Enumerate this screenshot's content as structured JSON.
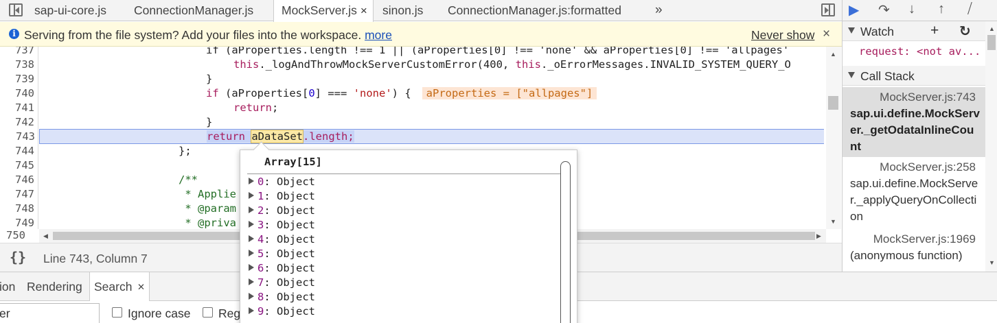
{
  "tabs": [
    {
      "label": "sap-ui-core.js"
    },
    {
      "label": "ConnectionManager.js"
    },
    {
      "label": "MockServer.js",
      "close": "×"
    },
    {
      "label": "sinon.js"
    },
    {
      "label": "ConnectionManager.js:formatted"
    }
  ],
  "tabs_overflow": "»",
  "infobar": {
    "message": "Serving from the file system? Add your files into the workspace.",
    "more_link": "more",
    "never_show": "Never show",
    "close": "×",
    "icon": "info-icon"
  },
  "editor": {
    "lines": [
      {
        "n": "737",
        "segments": [
          [
            "",
            "if (aProperties.length !== 1 || (aProperties[0] !== 'none' && aProperties[0] !== 'allpages'"
          ]
        ]
      },
      {
        "n": "738",
        "segments": [
          [
            "this",
            "this"
          ],
          [
            "",
            "._logAndThrowMockServerCustomError(400, "
          ],
          [
            "this",
            "this"
          ],
          [
            "",
            "._oErrorMessages.INVALID_SYSTEM_QUERY_O"
          ]
        ]
      },
      {
        "n": "739",
        "segments": [
          [
            "",
            "}"
          ]
        ]
      },
      {
        "n": "740",
        "segments": [
          [
            "kw2",
            "if"
          ],
          [
            "",
            " (aProperties["
          ],
          [
            "num",
            "0"
          ],
          [
            "",
            "] === "
          ],
          [
            "str",
            "'none'"
          ],
          [
            "",
            ") {"
          ]
        ]
      },
      {
        "n": "741",
        "segments": [
          [
            "kw2",
            "return"
          ],
          [
            "",
            ";"
          ]
        ]
      },
      {
        "n": "742",
        "segments": [
          [
            "",
            "}"
          ]
        ]
      },
      {
        "n": "743",
        "segments": [
          [
            "kw",
            "return"
          ],
          [
            "kw",
            " "
          ],
          [
            "hl",
            "aDataSet"
          ],
          [
            "kw",
            ".length;"
          ]
        ]
      },
      {
        "n": "744",
        "segments": [
          [
            "",
            "};"
          ]
        ]
      },
      {
        "n": "745",
        "segments": [
          [
            "",
            ""
          ]
        ]
      },
      {
        "n": "746",
        "segments": [
          [
            "cmt",
            "/**"
          ]
        ]
      },
      {
        "n": "747",
        "segments": [
          [
            "cmt",
            " * Applie"
          ]
        ]
      },
      {
        "n": "748",
        "segments": [
          [
            "cmt",
            " * @param"
          ]
        ]
      },
      {
        "n": "749",
        "segments": [
          [
            "cmt",
            " * @priva"
          ]
        ]
      },
      {
        "n": "750",
        "segments": [
          [
            "",
            ""
          ]
        ]
      }
    ],
    "inline_value_740": "aProperties = [\"allpages\"]",
    "status": "Line 743, Column 7",
    "pretty_print": "{}"
  },
  "popover": {
    "title": "Array[15]",
    "items": [
      {
        "key": "0",
        "value": "Object"
      },
      {
        "key": "1",
        "value": "Object"
      },
      {
        "key": "2",
        "value": "Object"
      },
      {
        "key": "3",
        "value": "Object"
      },
      {
        "key": "4",
        "value": "Object"
      },
      {
        "key": "5",
        "value": "Object"
      },
      {
        "key": "6",
        "value": "Object"
      },
      {
        "key": "7",
        "value": "Object"
      },
      {
        "key": "8",
        "value": "Object"
      },
      {
        "key": "9",
        "value": "Object"
      }
    ]
  },
  "drawer": {
    "tabs": [
      {
        "label": "ion"
      },
      {
        "label": "Rendering"
      },
      {
        "label": "Search",
        "close": "×"
      }
    ],
    "search_value": "er",
    "ignore_case": "Ignore case",
    "regex": "Reg"
  },
  "sidebar": {
    "watch": {
      "label": "Watch",
      "add": "+",
      "refresh": "↻",
      "item": "request: <not av..."
    },
    "call_stack": {
      "label": "Call Stack",
      "frames": [
        {
          "loc": "MockServer.js:743",
          "fn": "sap.ui.define.MockServer._getOdataInlineCount",
          "selected": true
        },
        {
          "loc": "MockServer.js:258",
          "fn": "sap.ui.define.MockServer._applyQueryOnCollection",
          "selected": false
        },
        {
          "loc": "MockServer.js:1969",
          "fn": "(anonymous function)",
          "selected": false
        }
      ]
    }
  },
  "colors": {
    "keyword": "#a71d5d",
    "string": "#b31b1b",
    "comment": "#236e25",
    "exec_line_bg": "#dbe3f9",
    "infobar_bg": "#fffbe0",
    "accent_blue": "#3b6fd8"
  }
}
